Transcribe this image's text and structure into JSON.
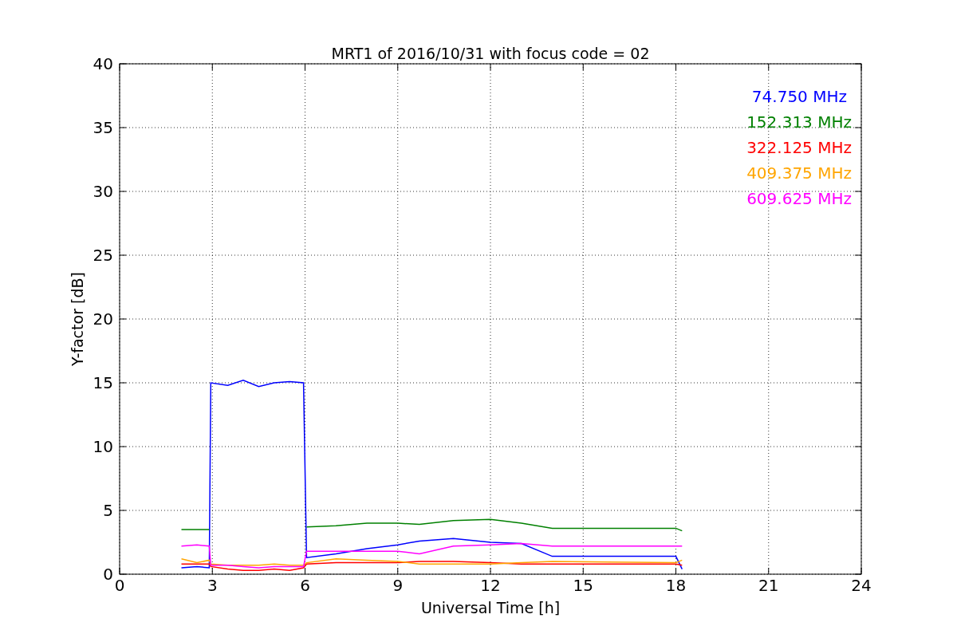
{
  "figure": {
    "chart_data": {
      "type": "line",
      "title": "MRT1 of 2016/10/31 with focus code = 02",
      "xlabel": "Universal Time [h]",
      "ylabel": "Y-factor [dB]",
      "x": [
        2,
        2.5,
        2.9,
        2.95,
        3.5,
        4,
        4.5,
        5,
        5.5,
        5.95,
        6.05,
        7,
        8,
        9,
        9.7,
        10.8,
        12,
        13,
        14,
        18,
        18.2
      ],
      "series": [
        {
          "name": "74.750 MHz",
          "color": "#0000ff",
          "values": [
            0.5,
            0.6,
            0.5,
            15,
            14.8,
            15.2,
            14.7,
            15,
            15.1,
            15,
            1.3,
            1.6,
            2.0,
            2.3,
            2.6,
            2.8,
            2.5,
            2.4,
            1.4,
            1.4,
            0.4
          ]
        },
        {
          "name": "152.313 MHz",
          "color": "#008000",
          "values": [
            3.5,
            3.5,
            3.5,
            null,
            null,
            null,
            null,
            null,
            null,
            null,
            3.7,
            3.8,
            4.0,
            4.0,
            3.9,
            4.2,
            4.3,
            4.0,
            3.6,
            3.6,
            3.4
          ]
        },
        {
          "name": "322.125 MHz",
          "color": "#ff0000",
          "values": [
            0.8,
            0.8,
            0.8,
            0.6,
            0.4,
            0.3,
            0.3,
            0.4,
            0.3,
            0.5,
            0.8,
            0.9,
            0.9,
            0.9,
            1.0,
            1.0,
            0.9,
            0.8,
            0.8,
            0.8,
            0.7
          ]
        },
        {
          "name": "409.375 MHz",
          "color": "#ffa500",
          "values": [
            1.2,
            0.9,
            1.1,
            0.8,
            0.7,
            0.7,
            0.7,
            0.8,
            0.7,
            0.7,
            0.9,
            1.2,
            1.1,
            1.0,
            0.8,
            0.8,
            0.8,
            0.9,
            1.0,
            0.9,
            1.1
          ]
        },
        {
          "name": "609.625 MHz",
          "color": "#ff00ff",
          "values": [
            2.2,
            2.3,
            2.2,
            0.7,
            0.7,
            0.6,
            0.5,
            0.6,
            0.6,
            0.6,
            1.8,
            1.8,
            1.8,
            1.8,
            1.6,
            2.2,
            2.3,
            2.4,
            2.2,
            2.2,
            2.2
          ]
        }
      ],
      "grid": true,
      "xlim": [
        0,
        24
      ],
      "ylim": [
        0,
        40
      ],
      "xticks": [
        0,
        3,
        6,
        9,
        12,
        15,
        18,
        21,
        24
      ],
      "yticks": [
        0,
        5,
        10,
        15,
        20,
        25,
        30,
        35,
        40
      ]
    }
  }
}
